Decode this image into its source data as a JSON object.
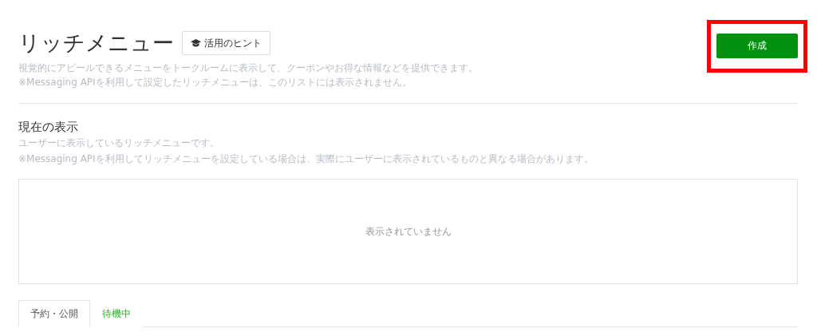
{
  "header": {
    "title": "リッチメニュー",
    "hint_button": "活用のヒント",
    "create_button": "作成",
    "create_highlighted": true,
    "description": [
      "視覚的にアピールできるメニューをトークルームに表示して、クーポンやお得な情報などを提供できます。",
      "※Messaging APIを利用して設定したリッチメニューは、このリストには表示されません。"
    ]
  },
  "current": {
    "title": "現在の表示",
    "description": [
      "ユーザーに表示しているリッチメニューです。",
      "※Messaging APIを利用してリッチメニューを設定している場合は、実際にユーザーに表示されているものと異なる場合があります。"
    ],
    "empty_message": "表示されていません"
  },
  "tabs": [
    {
      "label": "予約・公開",
      "selected": true
    },
    {
      "label": "待機中",
      "selected": false
    }
  ]
}
